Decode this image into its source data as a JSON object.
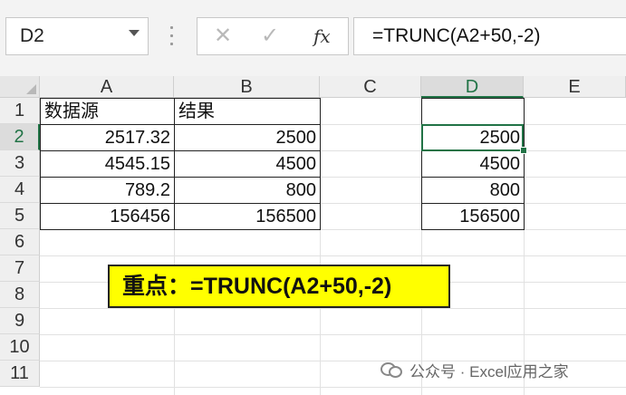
{
  "formula_bar": {
    "name_box": "D2",
    "cancel_icon": "✕",
    "enter_icon": "✓",
    "fx_label": "fx",
    "formula": "=TRUNC(A2+50,-2)"
  },
  "columns": [
    "A",
    "B",
    "C",
    "D",
    "E"
  ],
  "rows": [
    "1",
    "2",
    "3",
    "4",
    "5",
    "6",
    "7",
    "8",
    "9",
    "10",
    "11"
  ],
  "selected_cell": "D2",
  "cells": {
    "A1": "数据源",
    "B1": "结果",
    "A2": "2517.32",
    "B2": "2500",
    "A3": "4545.15",
    "B3": "4500",
    "A4": "789.2",
    "B4": "800",
    "A5": "156456",
    "B5": "156500",
    "D1": "",
    "D2": "2500",
    "D3": "4500",
    "D4": "800",
    "D5": "156500"
  },
  "note": {
    "text": "重点：=TRUNC(A2+50,-2)",
    "background": "#ffff00"
  },
  "watermark": "公众号 · Excel应用之家",
  "colors": {
    "accent": "#217346"
  }
}
